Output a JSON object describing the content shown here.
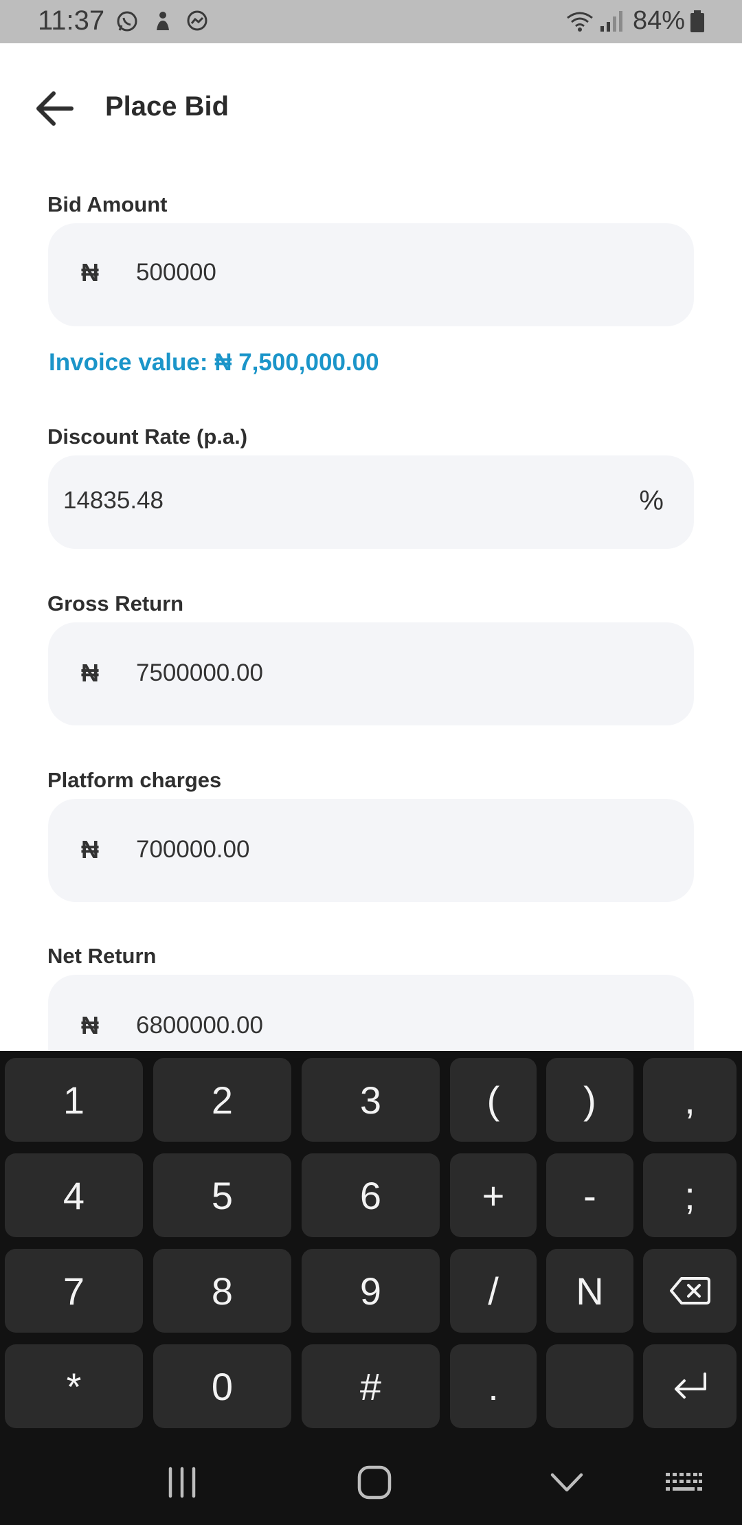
{
  "status_bar": {
    "time": "11:37",
    "battery": "84%",
    "notification_icons": [
      "whatsapp-icon",
      "app-icon",
      "messenger-icon"
    ],
    "system_icons": [
      "wifi-icon",
      "signal-icon",
      "battery-icon"
    ]
  },
  "header": {
    "title": "Place Bid",
    "back_icon": "arrow-left-icon"
  },
  "form": {
    "bid_amount": {
      "label": "Bid Amount",
      "currency": "₦",
      "value": "500000"
    },
    "invoice_value": "Invoice value: ₦ 7,500,000.00",
    "discount_rate": {
      "label": "Discount Rate (p.a.)",
      "value": "14835.48",
      "suffix": "%"
    },
    "gross_return": {
      "label": "Gross Return",
      "currency": "₦",
      "value": "7500000.00"
    },
    "platform_charges": {
      "label": "Platform charges",
      "currency": "₦",
      "value": "700000.00"
    },
    "net_return": {
      "label": "Net Return",
      "currency": "₦",
      "value": "6800000.00"
    }
  },
  "keyboard": {
    "rows": [
      [
        "1",
        "2",
        "3",
        "(",
        ")",
        ","
      ],
      [
        "4",
        "5",
        "6",
        "+",
        "-",
        ";"
      ],
      [
        "7",
        "8",
        "9",
        "/",
        "N",
        "backspace"
      ],
      [
        "*",
        "0",
        "#",
        ".",
        "",
        "enter"
      ]
    ]
  },
  "nav_bar": {
    "items": [
      "recents-icon",
      "home-icon",
      "hide-keyboard-icon",
      "keyboard-icon"
    ]
  },
  "colors": {
    "accent": "#1b95c9",
    "field_bg": "#f4f5f8",
    "status_bar_bg": "#bdbdbd",
    "keyboard_bg": "#121212",
    "key_bg": "#2b2b2b"
  }
}
